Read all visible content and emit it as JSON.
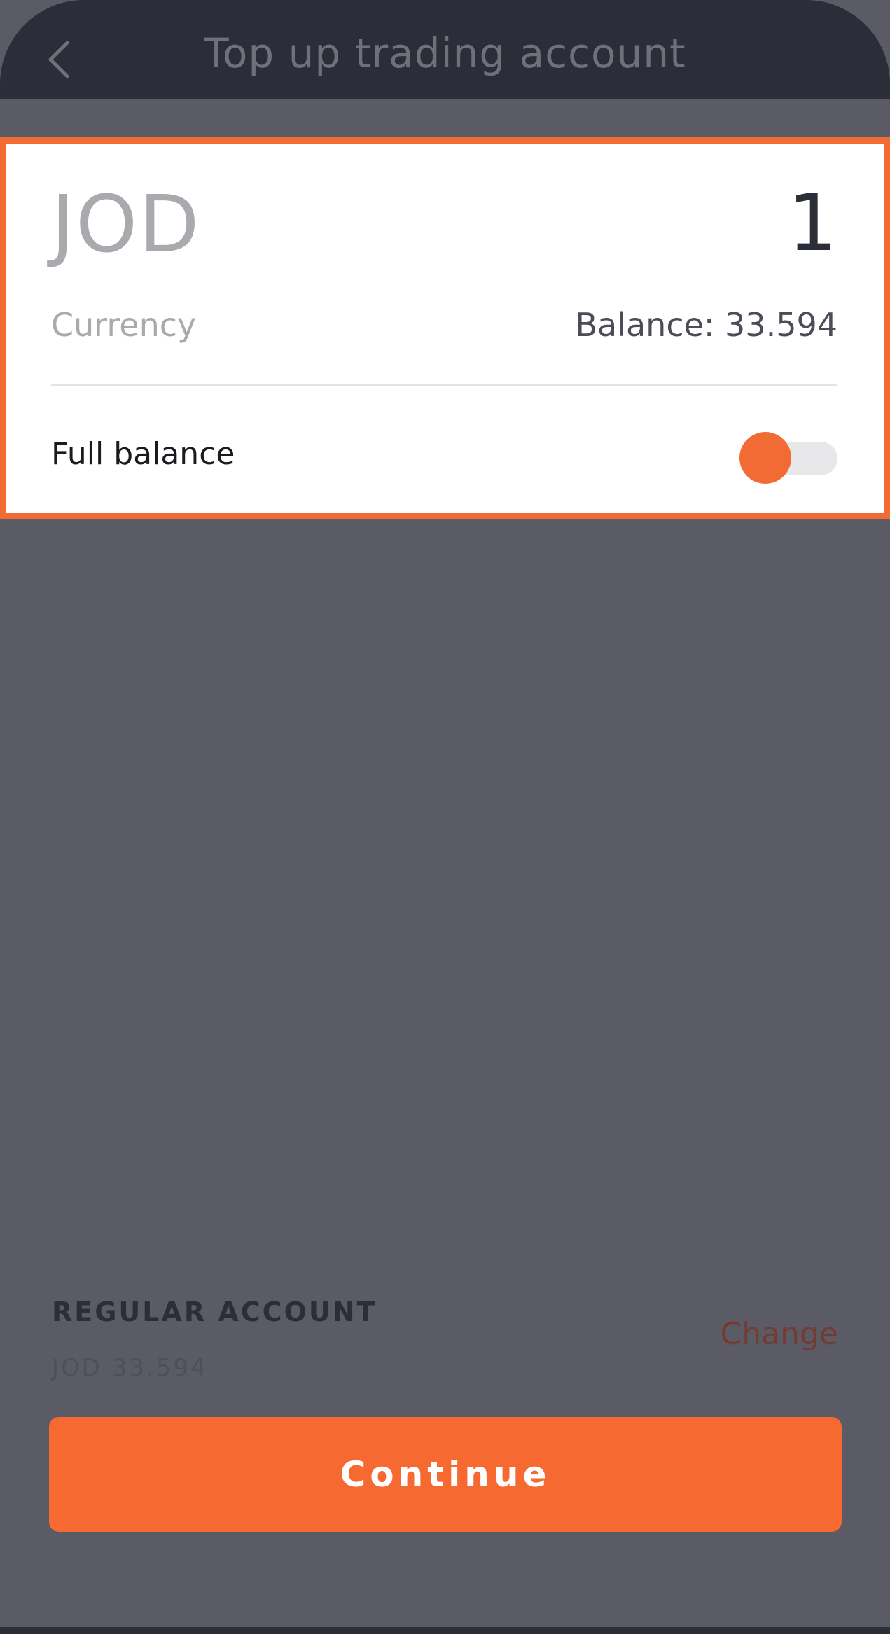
{
  "header": {
    "title": "Top up trading account",
    "back_icon": "chevron-left-icon"
  },
  "card": {
    "currency_code": "JOD",
    "amount": "1",
    "currency_label": "Currency",
    "balance_text": "Balance: 33.594",
    "full_balance_label": "Full balance",
    "full_balance_toggle_on": false
  },
  "account": {
    "type": "REGULAR ACCOUNT",
    "balance": "JOD 33.594",
    "change_label": "Change"
  },
  "actions": {
    "continue_label": "Continue"
  },
  "colors": {
    "accent": "#f26a34",
    "header_bg": "#2b2d38",
    "overlay_bg": "#5b5b66"
  }
}
